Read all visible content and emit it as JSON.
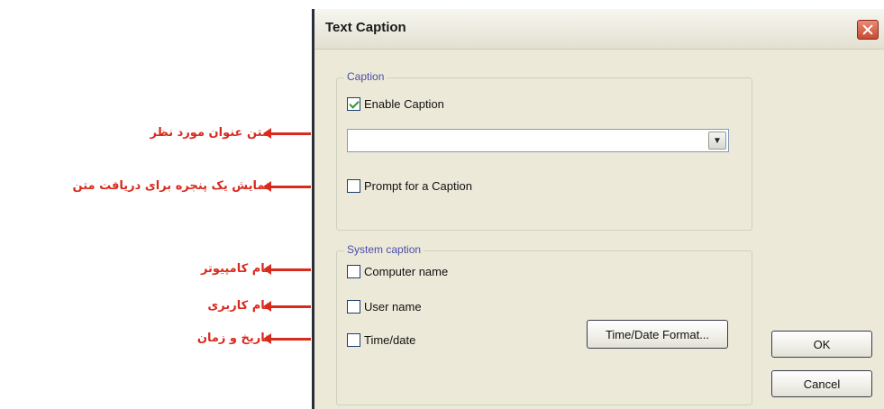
{
  "annotations": [
    {
      "text": "متن عنوان مورد نظر"
    },
    {
      "text": "نمایش یک پنجره برای دریافت متن"
    },
    {
      "text": "نام کامپیوتر"
    },
    {
      "text": "نام کاربری"
    },
    {
      "text": "تاریخ و زمان"
    }
  ],
  "dialog": {
    "title": "Text Caption",
    "caption_group": {
      "legend": "Caption",
      "enable_caption": {
        "label": "Enable Caption",
        "checked": true
      },
      "caption_text": {
        "value": ""
      },
      "prompt": {
        "label": "Prompt for a Caption",
        "checked": false
      }
    },
    "system_group": {
      "legend": "System caption",
      "computer_name": {
        "label": "Computer name",
        "checked": false
      },
      "user_name": {
        "label": "User name",
        "checked": false
      },
      "time_date": {
        "label": "Time/date",
        "checked": false
      },
      "format_button": "Time/Date Format..."
    },
    "ok_button": "OK",
    "cancel_button": "Cancel"
  },
  "colors": {
    "annotation": "#d92a1c",
    "legend": "#4a4ea8",
    "dialog_bg": "#ece9d8"
  }
}
